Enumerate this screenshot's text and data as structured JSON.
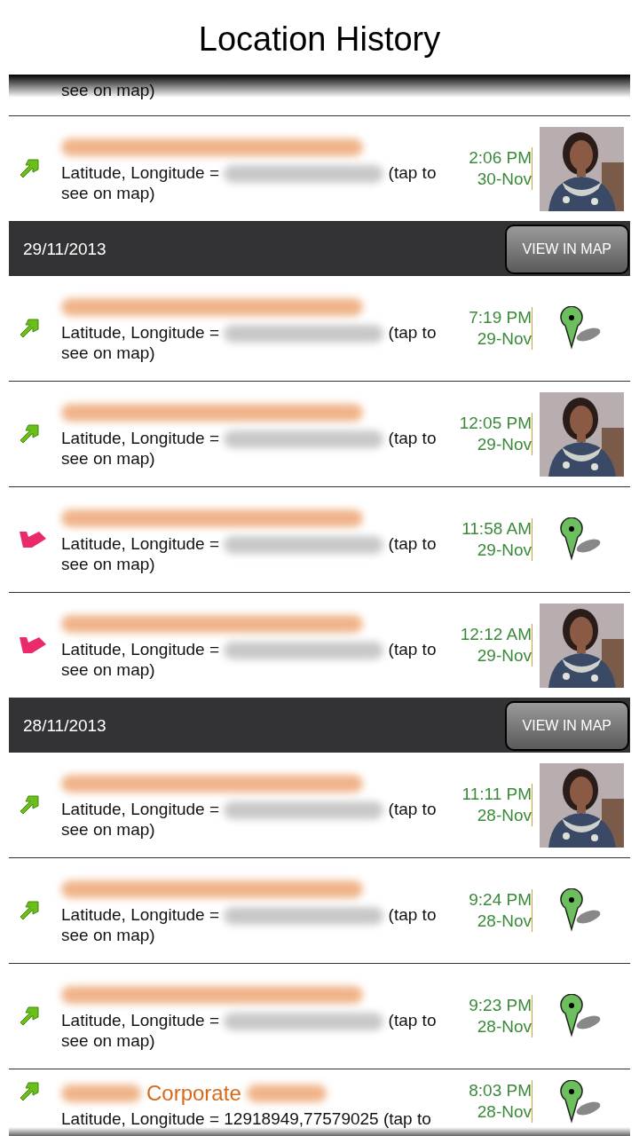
{
  "title": "Location History",
  "list": [
    {
      "kind": "partial",
      "tail": "see on map)"
    },
    {
      "kind": "entry",
      "icon": {
        "kind": "outgoing"
      },
      "name": [
        {
          "kind": "blurred"
        }
      ],
      "prefix": "Latitude, Longitude =",
      "coords": {
        "kind": "blurred"
      },
      "tail": "(tap to see on map)",
      "time": "2:06 PM",
      "date": "30-Nov"
    },
    {
      "kind": "date_header",
      "date": "29/11/2013",
      "button": "VIEW IN MAP"
    },
    {
      "kind": "entry",
      "icon": {
        "kind": "outgoing"
      },
      "name": [
        {
          "kind": "blurred"
        }
      ],
      "prefix": "Latitude, Longitude =",
      "coords": {
        "kind": "blurred"
      },
      "tail": "(tap to see on map)",
      "time": "7:19 PM",
      "date": "29-Nov",
      "thumb": {
        "kind": "pin"
      }
    },
    {
      "kind": "entry",
      "icon": {
        "kind": "outgoing"
      },
      "name": [
        {
          "kind": "blurred"
        }
      ],
      "prefix": "Latitude, Longitude =",
      "coords": {
        "kind": "blurred"
      },
      "tail": "(tap to see on map)",
      "time": "12:05 PM",
      "date": "29-Nov"
    },
    {
      "kind": "entry",
      "icon": {
        "kind": "incoming"
      },
      "name": [
        {
          "kind": "blurred"
        }
      ],
      "prefix": "Latitude, Longitude =",
      "coords": {
        "kind": "blurred"
      },
      "tail": "(tap to see on map)",
      "time": "11:58 AM",
      "date": "29-Nov",
      "thumb": {
        "kind": "pin"
      }
    },
    {
      "kind": "entry",
      "icon": {
        "kind": "incoming"
      },
      "name": [
        {
          "kind": "blurred"
        }
      ],
      "prefix": "Latitude, Longitude =",
      "coords": {
        "kind": "blurred"
      },
      "tail": "(tap to see on map)",
      "time": "12:12 AM",
      "date": "29-Nov"
    },
    {
      "kind": "date_header",
      "date": "28/11/2013",
      "button": "VIEW IN MAP"
    },
    {
      "kind": "entry",
      "icon": {
        "kind": "outgoing"
      },
      "name": [
        {
          "kind": "blurred"
        }
      ],
      "prefix": "Latitude, Longitude =",
      "coords": {
        "kind": "blurred"
      },
      "tail": "(tap to see on map)",
      "time": "11:11 PM",
      "date": "28-Nov"
    },
    {
      "kind": "entry",
      "icon": {
        "kind": "outgoing"
      },
      "name": [
        {
          "kind": "blurred"
        }
      ],
      "prefix": "Latitude, Longitude =",
      "coords": {
        "kind": "blurred"
      },
      "tail": "(tap to see on map)",
      "time": "9:24 PM",
      "date": "28-Nov",
      "thumb": {
        "kind": "pin"
      }
    },
    {
      "kind": "entry",
      "icon": {
        "kind": "outgoing"
      },
      "name": [
        {
          "kind": "blurred"
        }
      ],
      "prefix": "Latitude, Longitude =",
      "coords": {
        "kind": "blurred"
      },
      "tail": "(tap to see on map)",
      "time": "9:23 PM",
      "date": "28-Nov",
      "thumb": {
        "kind": "pin"
      }
    },
    {
      "kind": "entry",
      "icon": {
        "kind": "outgoing"
      },
      "name": [
        {
          "kind": "blurred"
        },
        {
          "kind": "text",
          "text": "Corporate"
        },
        {
          "kind": "blurred"
        }
      ],
      "prefix": "Latitude, Longitude =",
      "coords": {
        "kind": "text",
        "text": "12918949,77579025"
      },
      "tail": "(tap to",
      "time": "8:03 PM",
      "date": "28-Nov",
      "thumb": {
        "kind": "pin"
      }
    }
  ]
}
